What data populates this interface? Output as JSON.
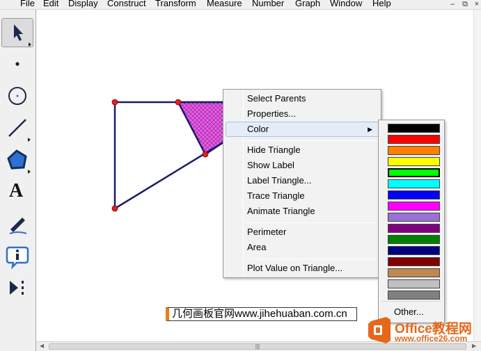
{
  "menubar": {
    "items": [
      "File",
      "Edit",
      "Display",
      "Construct",
      "Transform",
      "Measure",
      "Number",
      "Graph",
      "Window",
      "Help"
    ],
    "window_controls": [
      "–",
      "⧉",
      "×"
    ]
  },
  "toolbar": {
    "tools": [
      "arrow-select-tool",
      "point-tool",
      "compass-tool",
      "straightedge-tool",
      "polygon-tool",
      "text-tool",
      "marker-tool",
      "information-tool",
      "custom-tool"
    ],
    "text_tool_glyph": "A"
  },
  "context_menu": {
    "items": [
      "Select Parents",
      "Properties...",
      "Color",
      "Hide Triangle",
      "Show Label",
      "Label Triangle...",
      "Trace Triangle",
      "Animate Triangle",
      "Perimeter",
      "Area",
      "Plot Value on Triangle..."
    ],
    "highlighted": "Color",
    "submenu_arrow": "▶"
  },
  "color_menu": {
    "swatches": [
      "#000000",
      "#ff0000",
      "#ff8000",
      "#ffff00",
      "#00ff00",
      "#00ffff",
      "#0000ff",
      "#ff00ff",
      "#9a70d8",
      "#800080",
      "#008000",
      "#000080",
      "#800000",
      "#c08850",
      "#c0c0c0",
      "#808080"
    ],
    "selected_index": 4,
    "other_label": "Other..."
  },
  "watermark": {
    "text": "几何画板官网www.jihehuaban.com.cn"
  },
  "logo": {
    "title": "Office教程网",
    "url": "www.office26.com"
  },
  "scroll": {
    "thumb_grip": "|||"
  },
  "colors": {
    "triangle_stroke": "#1a1a6e",
    "fill": "#e060e0",
    "point": "#e02020",
    "logo_orange": "#e4671a"
  }
}
